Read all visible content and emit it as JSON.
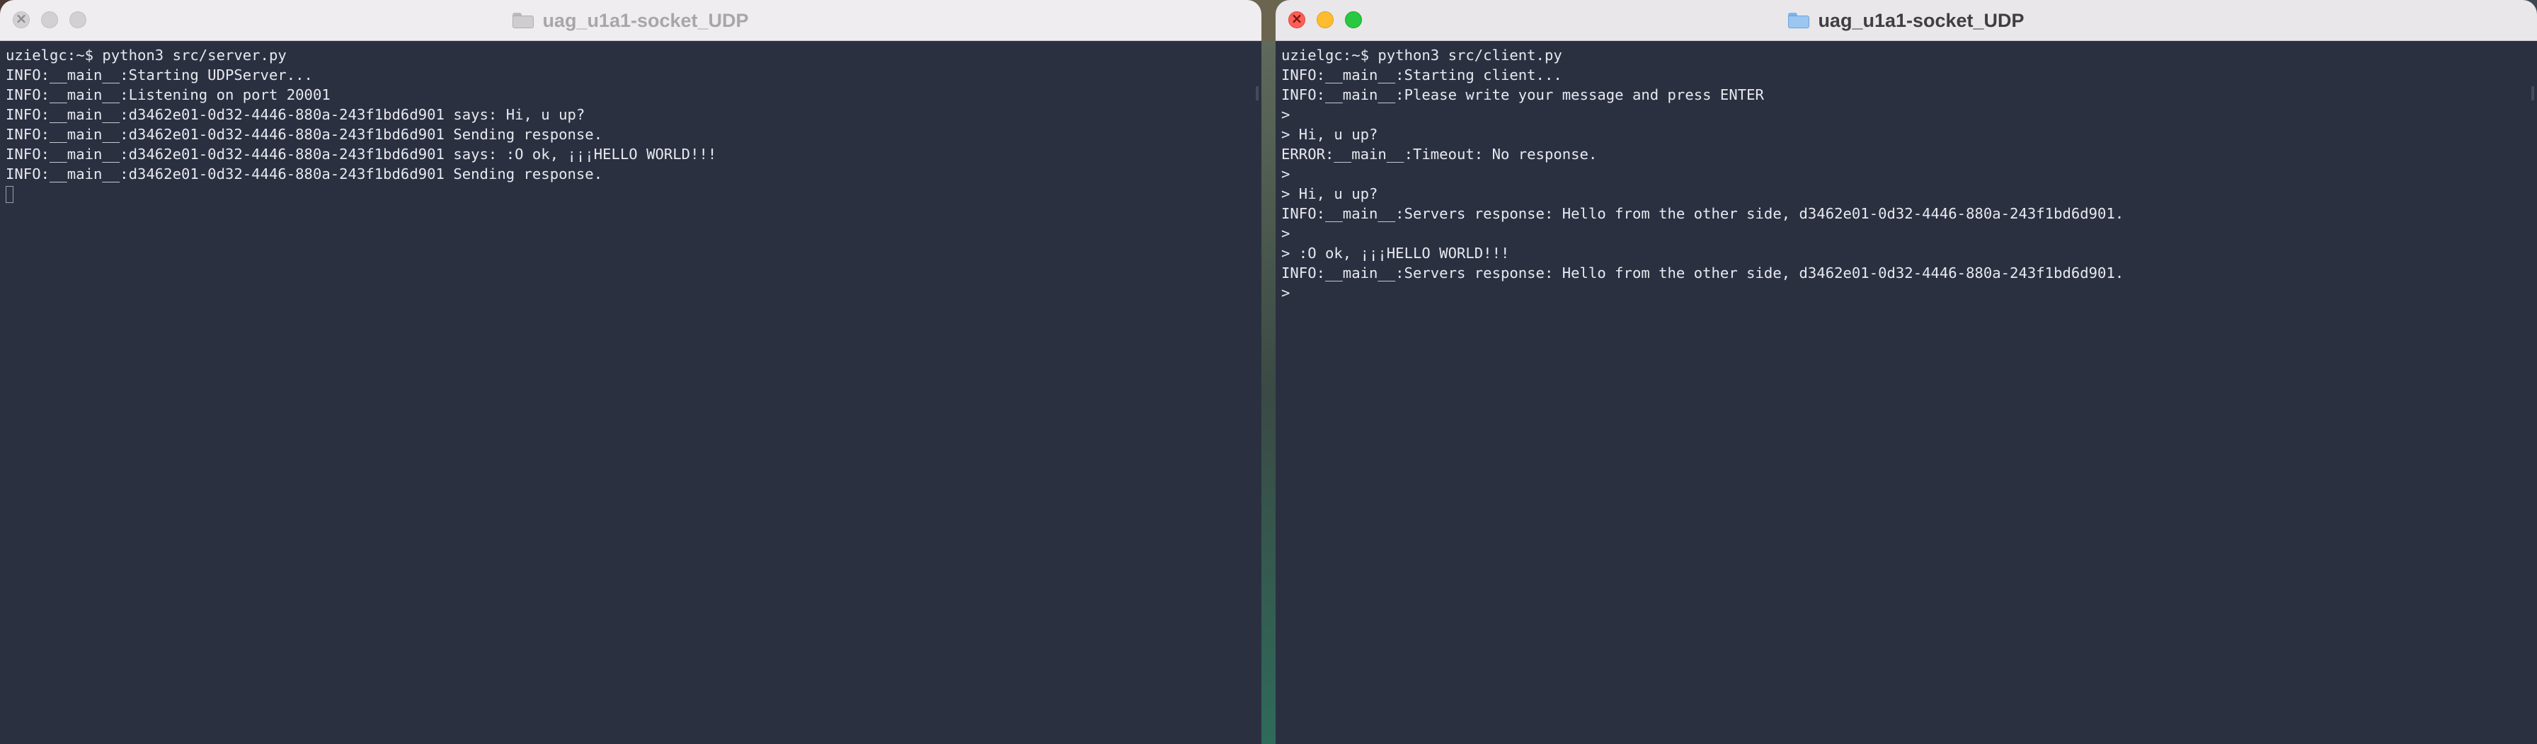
{
  "left_window": {
    "title": "uag_u1a1-socket_UDP",
    "active": false,
    "lines": [
      "uzielgc:~$ python3 src/server.py",
      "INFO:__main__:Starting UDPServer...",
      "INFO:__main__:Listening on port 20001",
      "INFO:__main__:d3462e01-0d32-4446-880a-243f1bd6d901 says: Hi, u up?",
      "INFO:__main__:d3462e01-0d32-4446-880a-243f1bd6d901 Sending response.",
      "INFO:__main__:d3462e01-0d32-4446-880a-243f1bd6d901 says: :O ok, ¡¡¡HELLO WORLD!!!",
      "INFO:__main__:d3462e01-0d32-4446-880a-243f1bd6d901 Sending response."
    ]
  },
  "right_window": {
    "title": "uag_u1a1-socket_UDP",
    "active": true,
    "lines": [
      "uzielgc:~$ python3 src/client.py",
      "INFO:__main__:Starting client...",
      "INFO:__main__:Please write your message and press ENTER",
      ">",
      "> Hi, u up?",
      "ERROR:__main__:Timeout: No response.",
      ">",
      "> Hi, u up?",
      "INFO:__main__:Servers response: Hello from the other side, d3462e01-0d32-4446-880a-243f1bd6d901.",
      ">",
      "> :O ok, ¡¡¡HELLO WORLD!!!",
      "INFO:__main__:Servers response: Hello from the other side, d3462e01-0d32-4446-880a-243f1bd6d901.",
      ">"
    ]
  },
  "icons": {
    "window_controls": [
      "close-icon",
      "minimize-icon",
      "zoom-icon"
    ],
    "title_icon": "folder-icon"
  },
  "colors": {
    "terminal_bg": "#2b3041",
    "terminal_fg": "#e7e9ef",
    "close": "#ff5f57",
    "minimize": "#febc2e",
    "zoom": "#28c840"
  }
}
